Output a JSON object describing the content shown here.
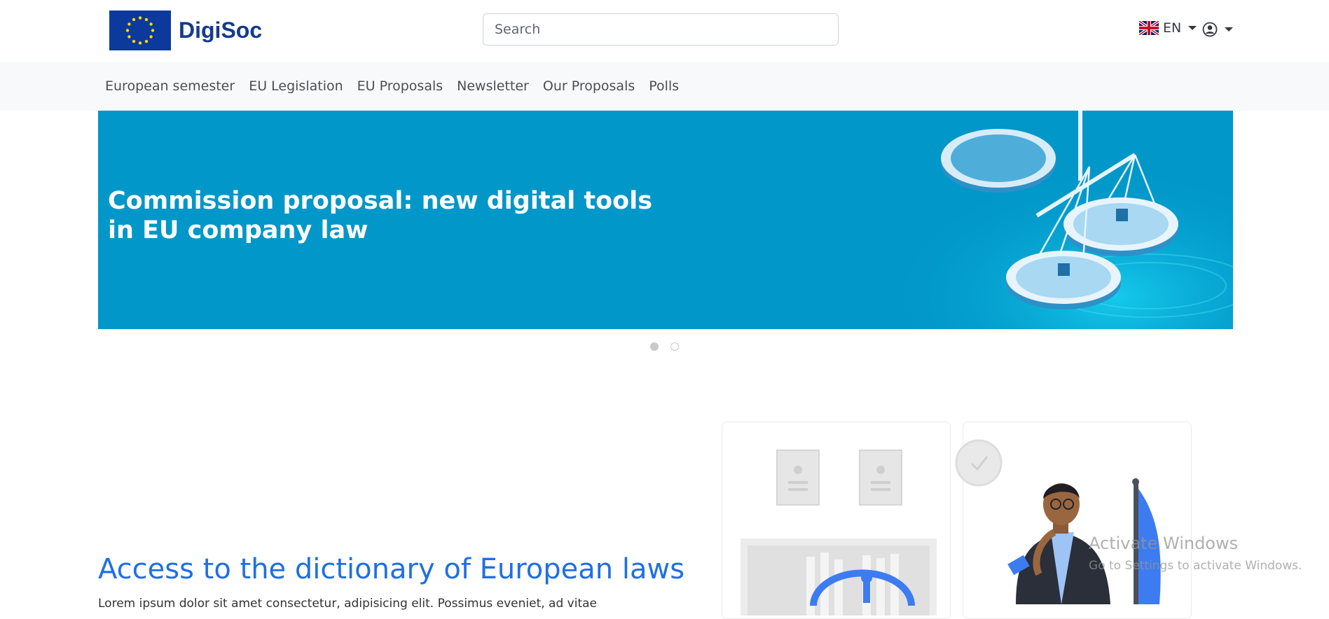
{
  "header": {
    "brand": "DigiSoc",
    "search": {
      "placeholder": "Search",
      "value": ""
    },
    "language": "EN"
  },
  "nav": {
    "items": [
      "European semester",
      "EU Legislation",
      "EU Proposals",
      "Newsletter",
      "Our Proposals",
      "Polls"
    ]
  },
  "carousel": {
    "title": "Commission proposal: new digital tools in EU company law",
    "slides_total": 2,
    "active_slide": 1,
    "background": "#0197c9"
  },
  "section": {
    "title": "Access to the dictionary of European laws",
    "body": "Lorem ipsum dolor sit amet consectetur, adipisicing elit. Possimus eveniet, ad vitae"
  },
  "watermark": {
    "line1": "Activate Windows",
    "line2": "Go to Settings to activate Windows."
  },
  "colors": {
    "accent": "#1f6fe5",
    "brand": "#123a8f",
    "hero": "#0197c9"
  }
}
